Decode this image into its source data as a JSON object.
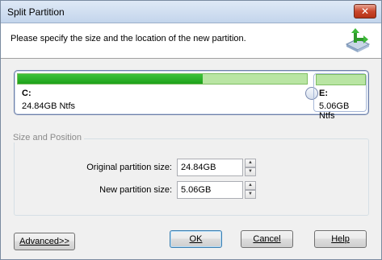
{
  "window": {
    "title": "Split Partition",
    "close_label": "✕"
  },
  "header": {
    "instruction": "Please specify the size and the location of the new partition.",
    "icon": "split-partition-icon"
  },
  "disk_map": {
    "partitions": [
      {
        "letter": "C:",
        "info": "24.84GB Ntfs",
        "used_fraction": 0.64
      },
      {
        "letter": "E:",
        "info": "5.06GB Ntfs"
      }
    ]
  },
  "size_position": {
    "group_title": "Size and Position",
    "original_label": "Original partition size:",
    "original_value": "24.84GB",
    "new_label": "New partition size:",
    "new_value": "5.06GB"
  },
  "buttons": {
    "advanced": "Advanced>>",
    "ok": "OK",
    "cancel": "Cancel",
    "help": "Help"
  }
}
